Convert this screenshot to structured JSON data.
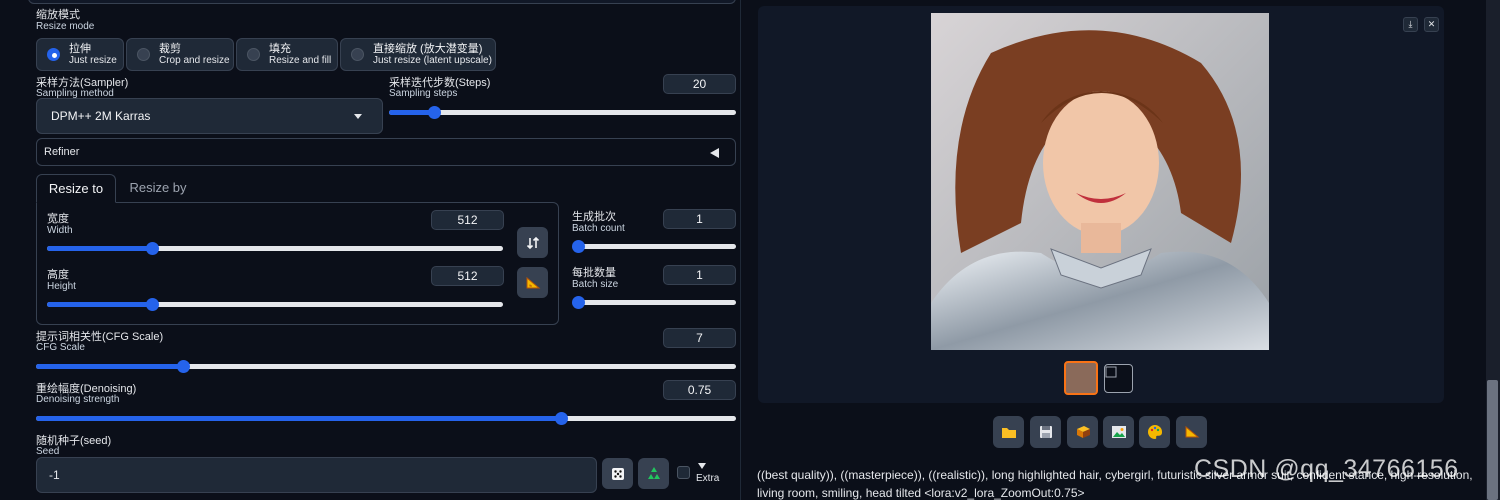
{
  "resize_mode": {
    "label_cn": "缩放模式",
    "label_en": "Resize mode",
    "options": [
      {
        "cn": "拉伸",
        "en": "Just resize",
        "selected": true
      },
      {
        "cn": "裁剪",
        "en": "Crop and resize",
        "selected": false
      },
      {
        "cn": "填充",
        "en": "Resize and fill",
        "selected": false
      },
      {
        "cn": "直接缩放 (放大潜变量)",
        "en": "Just resize (latent upscale)",
        "selected": false
      }
    ]
  },
  "sampler": {
    "label_cn": "采样方法(Sampler)",
    "label_en": "Sampling method",
    "value": "DPM++ 2M Karras"
  },
  "steps": {
    "label_cn": "采样迭代步数(Steps)",
    "label_en": "Sampling steps",
    "value": "20",
    "fraction": 0.13
  },
  "refiner": {
    "label": "Refiner"
  },
  "size_tabs": [
    {
      "label": "Resize to",
      "active": true
    },
    {
      "label": "Resize by",
      "active": false
    }
  ],
  "width": {
    "label_cn": "宽度",
    "label_en": "Width",
    "value": "512",
    "fraction": 0.23
  },
  "height": {
    "label_cn": "高度",
    "label_en": "Height",
    "value": "512",
    "fraction": 0.23
  },
  "batch_count": {
    "label_cn": "生成批次",
    "label_en": "Batch count",
    "value": "1",
    "fraction": 0.0
  },
  "batch_size": {
    "label_cn": "每批数量",
    "label_en": "Batch size",
    "value": "1",
    "fraction": 0.0
  },
  "cfg": {
    "label_cn": "提示词相关性(CFG Scale)",
    "label_en": "CFG Scale",
    "value": "7",
    "fraction": 0.21
  },
  "denoise": {
    "label_cn": "重绘幅度(Denoising)",
    "label_en": "Denoising strength",
    "value": "0.75",
    "fraction": 0.75
  },
  "seed": {
    "label_cn": "随机种子(seed)",
    "label_en": "Seed",
    "value": "-1",
    "extra_label": "Extra"
  },
  "icons": {
    "swap": "swap-arrows-icon",
    "ratio": "ruler-triangle-icon",
    "dice": "dice-icon",
    "recycle": "recycle-icon"
  },
  "output_toolbar": [
    "folder-icon",
    "save-icon",
    "zip-icon",
    "image-icon",
    "palette-icon",
    "ruler-triangle-icon"
  ],
  "prompt_text": "((best quality)), ((masterpiece)), ((realistic)), long highlighted hair, cybergirl, futuristic silver armor suit, confident stance, high-resolution, living room, smiling, head tilted <lora:v2_lora_ZoomOut:0.75>",
  "watermark": "CSDN @qq_34766156",
  "colors": {
    "accent": "#2563eb",
    "bg": "#0b0f19",
    "panel": "#1f2937"
  }
}
